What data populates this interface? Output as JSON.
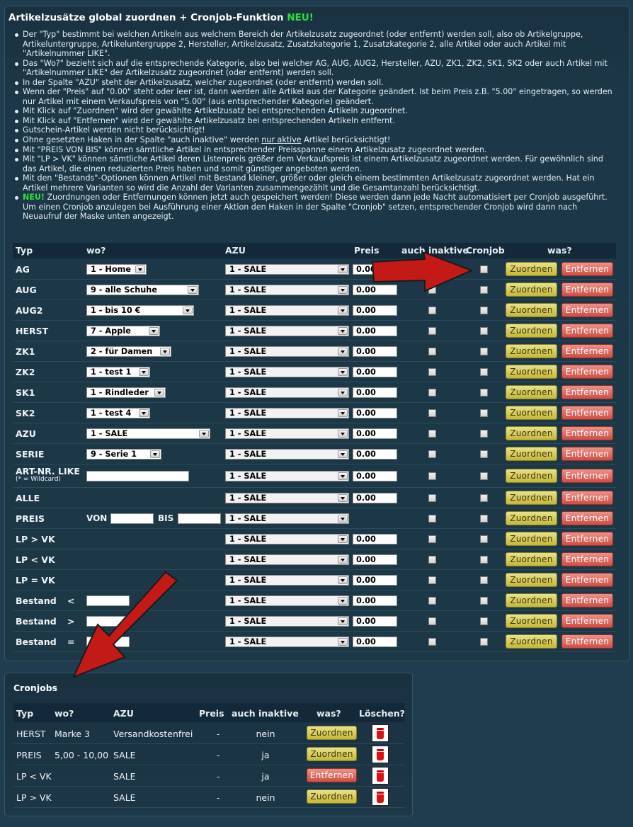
{
  "header": {
    "title": "Artikelzusätze global zuordnen + Cronjob-Funktion",
    "title_badge": "NEU!"
  },
  "info": [
    "Der \"Typ\" bestimmt bei welchen Artikeln aus welchem Bereich der Artikelzusatz zugeordnet (oder entfernt) werden soll, also ob Artikelgruppe, Artikeluntergruppe, Artikeluntergruppe 2, Hersteller, Artikelzusatz, Zusatzkategorie 1, Zusatzkategorie 2, alle Artikel oder auch Artikel mit \"Artikelnummer LIKE\".",
    "Das \"Wo?\" bezieht sich auf die entsprechende Kategorie, also bei welcher AG, AUG, AUG2, Hersteller, AZU, ZK1, ZK2, SK1, SK2 oder auch Artikel mit \"Artikelnummer LIKE\" der Artikelzusatz zugeordnet (oder entfernt) werden soll.",
    "In der Spalte \"AZU\" steht der Artikelzusatz, welcher zugeordnet (oder entfernt) werden soll.",
    "Wenn der \"Preis\" auf \"0.00\" steht oder leer ist, dann werden alle Artikel aus der Kategorie geändert. Ist beim Preis z.B. \"5.00\" eingetragen, so werden nur Artikel mit einem Verkaufspreis von \"5.00\" (aus entsprechender Kategorie) geändert.",
    "Mit Klick auf \"Zuordnen\" wird der gewählte Artikelzusatz bei entsprechenden Artikeln zugeordnet.",
    "Mit Klick auf \"Entfernen\" wird der gewählte Artikelzusatz bei entsprechenden Artikeln entfernt.",
    "Gutschein-Artikel werden nicht berücksichtigt!",
    "Mit \"PREIS VON BIS\" können sämtliche Artikel in entsprechender Preisspanne einem Artikelzusatz zugeordnet werden.",
    "Mit \"LP > VK\" können sämtliche Artikel deren Listenpreis größer dem Verkaufspreis ist einem Artikelzusatz zugeordnet werden. Für gewöhnlich sind das Artikel, die einen reduzierten Preis haben und somit günstiger angeboten werden.",
    "Mit den \"Bestands\"-Optionen können Artikel mit Bestand kleiner, größer oder gleich einem bestimmten Artikelzusatz zugeordnet werden. Hat ein Artikel mehrere Varianten so wird die Anzahl der Varianten zusammengezählt und die Gesamtanzahl berücksichtigt."
  ],
  "info_inaktiv": {
    "pre": "Ohne gesetzten Haken in der Spalte \"auch inaktive\" werden ",
    "u": "nur aktive",
    "post": " Artikel berücksichtigt!"
  },
  "info_neu": {
    "badge": "NEU!",
    "text": " Zuordnungen oder Entfernungen können jetzt auch gespeichert werden! Diese werden dann jede Nacht automatisiert per Cronjob ausgeführt. Um einen Cronjob anzulegen bei Ausführung einer Aktion den Haken in der Spalte \"Cronjob\" setzen, entsprechender Cronjob wird dann nach Neuaufruf der Maske unten angezeigt."
  },
  "columns": {
    "typ": "Typ",
    "wo": "wo?",
    "azu": "AZU",
    "preis": "Preis",
    "inaktiv": "auch inaktive",
    "cronjob": "Cronjob",
    "was": "was?"
  },
  "buttons": {
    "zuordnen": "Zuordnen",
    "entfernen": "Entfernen"
  },
  "rows": [
    {
      "label": "AG",
      "wo": "1 - Home",
      "azu": "1 - SALE",
      "preis": "0.00"
    },
    {
      "label": "AUG",
      "wo": "9 - alle Schuhe",
      "azu": "1 - SALE",
      "preis": "0.00"
    },
    {
      "label": "AUG2",
      "wo": "1 - bis 10 €",
      "azu": "1 - SALE",
      "preis": "0.00"
    },
    {
      "label": "HERST",
      "wo": "7 - Apple",
      "azu": "1 - SALE",
      "preis": "0.00"
    },
    {
      "label": "ZK1",
      "wo": "2 - für Damen",
      "azu": "1 - SALE",
      "preis": "0.00"
    },
    {
      "label": "ZK2",
      "wo": "1 - test 1",
      "azu": "1 - SALE",
      "preis": "0.00"
    },
    {
      "label": "SK1",
      "wo": "1 - Rindleder",
      "azu": "1 - SALE",
      "preis": "0.00"
    },
    {
      "label": "SK2",
      "wo": "1 - test 4",
      "azu": "1 - SALE",
      "preis": "0.00"
    },
    {
      "label": "AZU",
      "wo": "1 - SALE",
      "azu": "1 - SALE",
      "preis": "0.00"
    },
    {
      "label": "SERIE",
      "wo": "9 - Serie 1",
      "azu": "1 - SALE",
      "preis": "0.00"
    },
    {
      "label": "ART-NR. LIKE",
      "note": "(* = Wildcard)",
      "azu": "1 - SALE",
      "preis": "0.00"
    },
    {
      "label": "ALLE",
      "azu": "1 - SALE",
      "preis": "0.00"
    },
    {
      "label": "PREIS",
      "von": "VON",
      "bis": "BIS",
      "azu": "1 - SALE"
    },
    {
      "label": "LP > VK",
      "azu": "1 - SALE",
      "preis": "0.00"
    },
    {
      "label": "LP < VK",
      "azu": "1 - SALE",
      "preis": "0.00"
    },
    {
      "label": "LP = VK",
      "azu": "1 - SALE",
      "preis": "0.00"
    },
    {
      "label": "Bestand",
      "op": "<",
      "azu": "1 - SALE",
      "preis": "0.00"
    },
    {
      "label": "Bestand",
      "op": ">",
      "azu": "1 - SALE",
      "preis": "0.00"
    },
    {
      "label": "Bestand",
      "op": "=",
      "azu": "1 - SALE",
      "preis": "0.00"
    }
  ],
  "cronjobs": {
    "title": "Cronjobs",
    "columns": {
      "typ": "Typ",
      "wo": "wo?",
      "azu": "AZU",
      "preis": "Preis",
      "inaktiv": "auch inaktive",
      "was": "was?",
      "loeschen": "Löschen?"
    },
    "rows": [
      {
        "typ": "HERST",
        "wo": "Marke 3",
        "azu": "Versandkostenfrei",
        "preis": "-",
        "inaktiv": "nein",
        "was": "Zuordnen",
        "kind": "z"
      },
      {
        "typ": "PREIS",
        "wo": "5,00 - 10,00",
        "azu": "SALE",
        "preis": "-",
        "inaktiv": "ja",
        "was": "Zuordnen",
        "kind": "z"
      },
      {
        "typ": "LP < VK",
        "wo": "",
        "azu": "SALE",
        "preis": "-",
        "inaktiv": "ja",
        "was": "Entfernen",
        "kind": "e"
      },
      {
        "typ": "LP > VK",
        "wo": "",
        "azu": "SALE",
        "preis": "-",
        "inaktiv": "nein",
        "was": "Zuordnen",
        "kind": "z"
      }
    ]
  },
  "colors": {
    "background": "#1f3d4e",
    "neu": "#2fe03d",
    "zuordnen": "#d6cc5a",
    "entfernen": "#e06d63",
    "arrow": "#c41a17"
  }
}
